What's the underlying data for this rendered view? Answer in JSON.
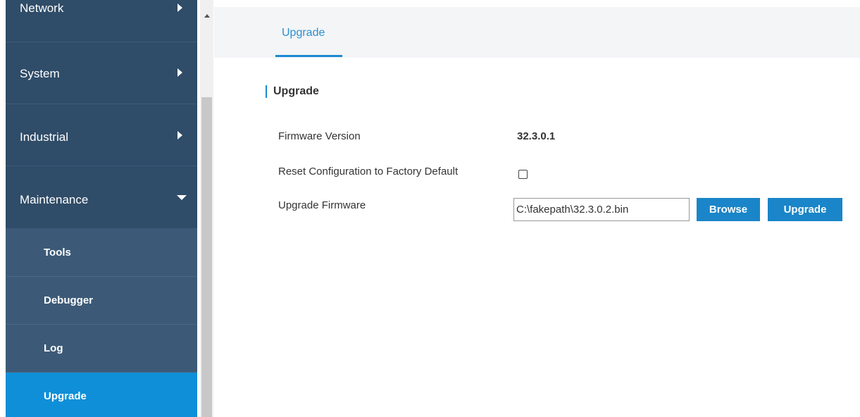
{
  "sidebar": {
    "items": [
      {
        "label": "Network"
      },
      {
        "label": "System"
      },
      {
        "label": "Industrial"
      },
      {
        "label": "Maintenance"
      }
    ],
    "subitems": [
      {
        "label": "Tools"
      },
      {
        "label": "Debugger"
      },
      {
        "label": "Log"
      },
      {
        "label": "Upgrade"
      }
    ]
  },
  "tabs": [
    {
      "label": "Upgrade"
    }
  ],
  "section": {
    "title": "Upgrade"
  },
  "form": {
    "firmware_version_label": "Firmware Version",
    "firmware_version_value": "32.3.0.1",
    "reset_label": "Reset Configuration to Factory Default",
    "upgrade_firmware_label": "Upgrade Firmware",
    "file_path": "C:\\fakepath\\32.3.0.2.bin",
    "browse_label": "Browse",
    "upgrade_label": "Upgrade"
  },
  "colors": {
    "sidebar_bg": "#2f4c68",
    "submenu_bg": "#3c5a77",
    "active_bg": "#0f8fd8",
    "accent": "#1a8ad4",
    "button_bg": "#1a85c8"
  },
  "icons": {
    "expand": "caret-right-icon",
    "collapse": "caret-down-icon",
    "scroll_up": "scroll-up-arrow-icon"
  }
}
